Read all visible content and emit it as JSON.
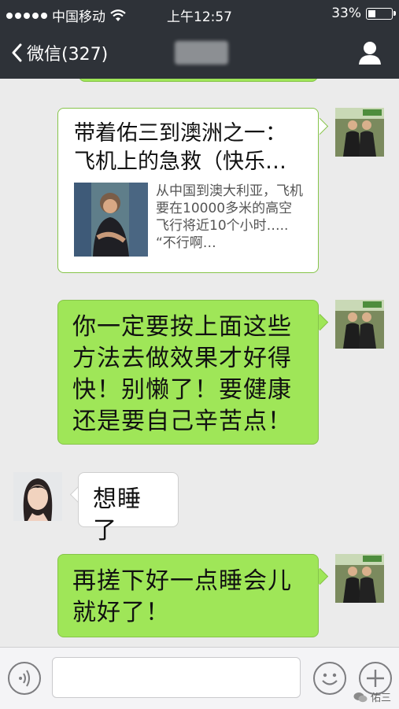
{
  "status_bar": {
    "carrier": "中国移动",
    "time": "上午12:57",
    "battery": "33%",
    "battery_level": 0.33
  },
  "nav": {
    "back_label": "微信(327)"
  },
  "messages": [
    {
      "type": "article_card",
      "side": "right",
      "title": "带着佑三到澳洲之一：飞机上的急救（快乐…",
      "description": "从中国到澳大利亚，飞机要在10000多米的高空飞行将近10个小时….. “不行啊…"
    },
    {
      "type": "text",
      "side": "right",
      "text_lines": [
        "你一定要按上面这些",
        "方法去做效果才好得",
        "快！别懒了！要健康",
        "还是要自己辛苦点！"
      ]
    },
    {
      "type": "text",
      "side": "left",
      "text_lines": [
        "想睡了"
      ]
    },
    {
      "type": "text",
      "side": "right",
      "text_lines": [
        "再搓下好一点睡会儿",
        "就好了！"
      ]
    }
  ],
  "input_bar": {
    "placeholder": "",
    "watermark": "佑三"
  },
  "icons": {
    "signal": "signal-dots-icon",
    "wifi": "wifi-icon",
    "back": "chevron-left-icon",
    "contact": "person-icon",
    "voice": "voice-icon",
    "emoji": "emoji-icon",
    "plus": "plus-icon"
  },
  "colors": {
    "header_bg": "#2e3238",
    "chat_bg": "#ebebeb",
    "bubble_green": "#9fe658",
    "bubble_white": "#ffffff"
  }
}
